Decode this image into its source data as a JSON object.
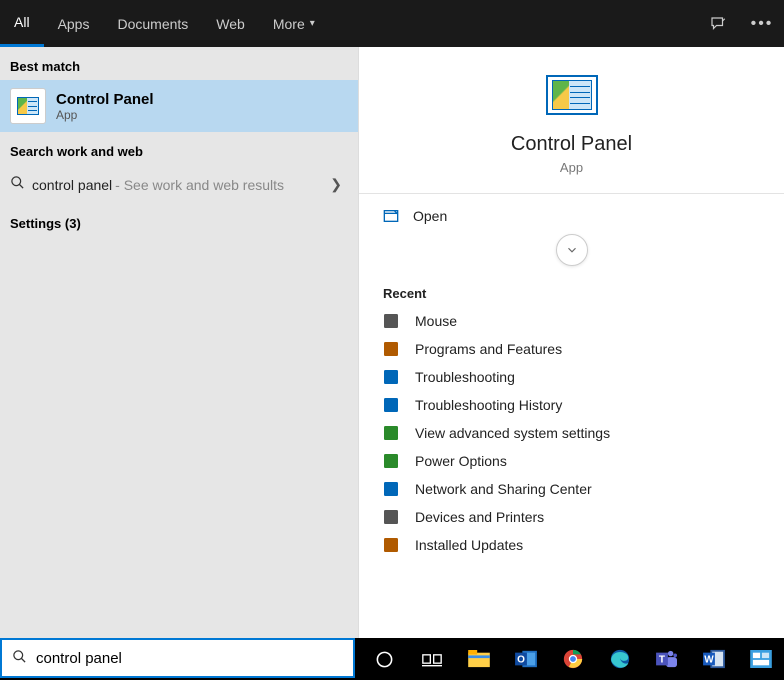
{
  "tabs": {
    "all": "All",
    "apps": "Apps",
    "documents": "Documents",
    "web": "Web",
    "more": "More"
  },
  "sections": {
    "best": "Best match",
    "web": "Search work and web",
    "settings": "Settings (3)"
  },
  "best_match": {
    "title": "Control Panel",
    "subtitle": "App"
  },
  "web_query": {
    "text": "control panel",
    "hint": " - See work and web results"
  },
  "preview": {
    "title": "Control Panel",
    "subtitle": "App",
    "open_label": "Open",
    "recent_label": "Recent"
  },
  "recent": [
    {
      "label": "Mouse",
      "color": "#555"
    },
    {
      "label": "Programs and Features",
      "color": "#b05a00"
    },
    {
      "label": "Troubleshooting",
      "color": "#0067b8"
    },
    {
      "label": "Troubleshooting History",
      "color": "#0067b8"
    },
    {
      "label": "View advanced system settings",
      "color": "#2a8a2a"
    },
    {
      "label": "Power Options",
      "color": "#2a8a2a"
    },
    {
      "label": "Network and Sharing Center",
      "color": "#0067b8"
    },
    {
      "label": "Devices and Printers",
      "color": "#555"
    },
    {
      "label": "Installed Updates",
      "color": "#b05a00"
    }
  ],
  "search": {
    "value": "control panel"
  },
  "taskbar_icons": [
    "cortana",
    "task-view",
    "file-explorer",
    "outlook",
    "chrome",
    "edge",
    "teams",
    "word",
    "preview-app"
  ]
}
